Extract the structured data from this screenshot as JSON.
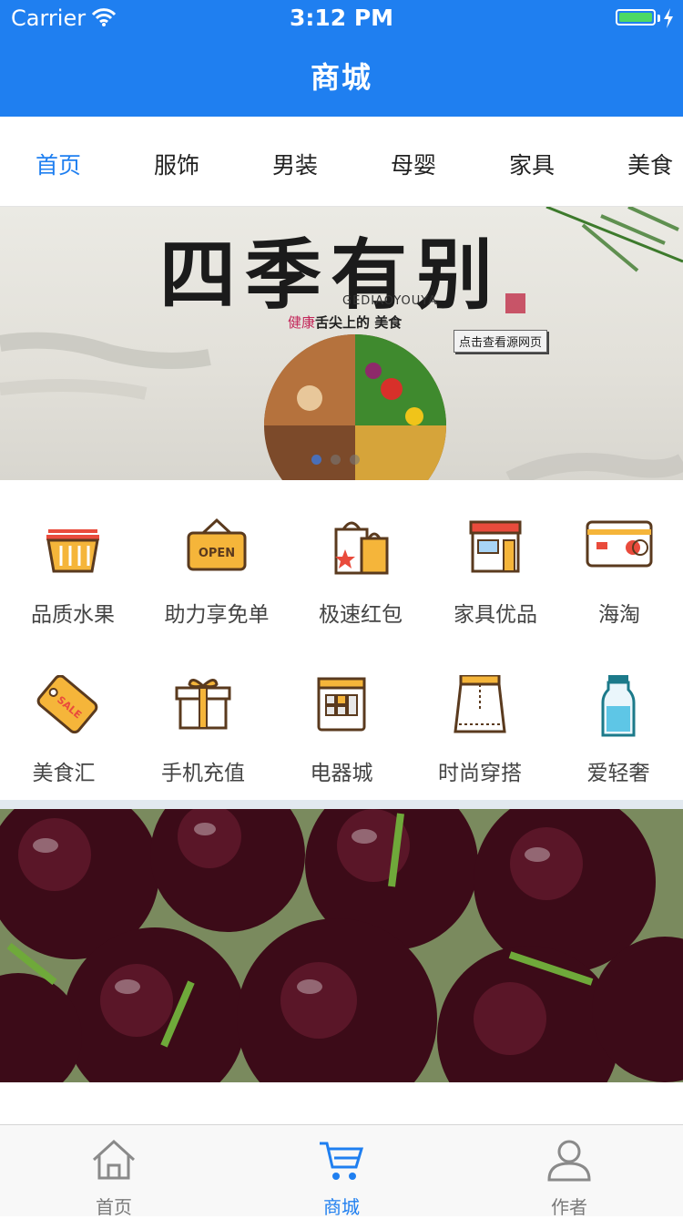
{
  "status": {
    "carrier": "Carrier",
    "time": "3:12 PM"
  },
  "nav": {
    "title": "商城"
  },
  "tabs": [
    "首页",
    "服饰",
    "男装",
    "母婴",
    "家具",
    "美食"
  ],
  "banner": {
    "title": "四季有别",
    "subtitle": "GEDIAOYOUYA",
    "slogan_highlight": "健康",
    "slogan_rest": "舌尖上的 美食",
    "button": "点击查看源网页"
  },
  "grid": [
    {
      "label": "品质水果",
      "icon": "basket-icon"
    },
    {
      "label": "助力享免单",
      "icon": "open-sign-icon"
    },
    {
      "label": "极速红包",
      "icon": "shopping-bag-icon"
    },
    {
      "label": "家具优品",
      "icon": "store-icon"
    },
    {
      "label": "海淘",
      "icon": "credit-card-icon"
    },
    {
      "label": "美食汇",
      "icon": "sale-tag-icon"
    },
    {
      "label": "手机充值",
      "icon": "gift-box-icon"
    },
    {
      "label": "电器城",
      "icon": "calculator-icon"
    },
    {
      "label": "时尚穿搭",
      "icon": "skirt-icon"
    },
    {
      "label": "爱轻奢",
      "icon": "milk-bottle-icon"
    }
  ],
  "tabbar": [
    {
      "label": "首页",
      "icon": "home-icon"
    },
    {
      "label": "商城",
      "icon": "cart-icon"
    },
    {
      "label": "作者",
      "icon": "user-icon"
    }
  ],
  "colors": {
    "accent": "#1f7ff0",
    "orange": "#f5a623",
    "red": "#e94b3c"
  }
}
